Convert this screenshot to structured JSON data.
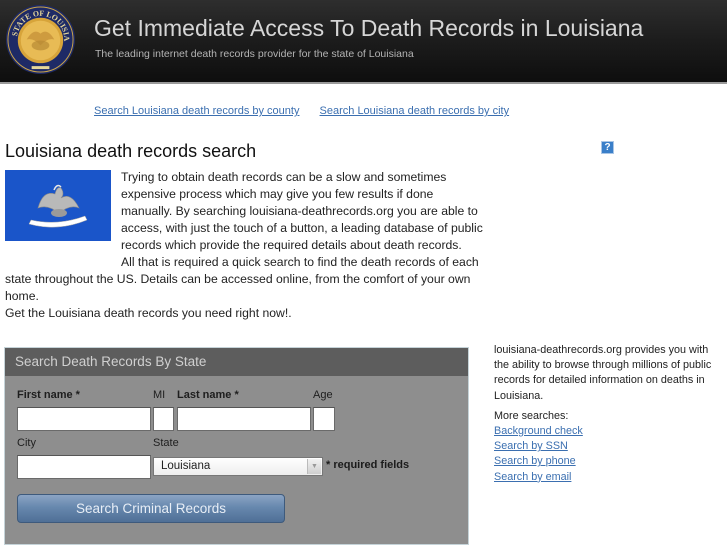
{
  "header": {
    "title": "Get Immediate Access To Death Records in Louisiana",
    "subtitle": "The leading internet death records provider for the state of Louisiana",
    "seal_icon": "state-of-louisiana-seal",
    "seal_text": "STATE OF LOUISIANA"
  },
  "top_links": [
    {
      "label": "Search Louisiana death records by county"
    },
    {
      "label": "Search Louisiana death records by city"
    }
  ],
  "main": {
    "title": "Louisiana death records search",
    "help_icon": "?",
    "flag_image": "louisiana-flag",
    "paragraphs": [
      "Trying to obtain death records can be a slow and sometimes expensive process which may give you few results if done manually. By searching louisiana-deathrecords.org you are able to access, with just the touch of a button, a leading database of public records which provide the required details about death records.",
      "All that is required a quick search to find the death records of each state throughout the US. Details can be accessed online, from the comfort of your own home.",
      "Get the Louisiana death records you need right now!."
    ]
  },
  "search_form": {
    "header": "Search Death Records By State",
    "fields": {
      "first_name": {
        "label": "First name *",
        "value": ""
      },
      "mi": {
        "label": "MI",
        "value": ""
      },
      "last_name": {
        "label": "Last name *",
        "value": ""
      },
      "age": {
        "label": "Age",
        "value": ""
      },
      "city": {
        "label": "City",
        "value": ""
      },
      "state": {
        "label": "State",
        "value": "Louisiana"
      }
    },
    "required_note": "* required fields",
    "submit_label": "Search Criminal Records"
  },
  "sidebar": {
    "description": "louisiana-deathrecords.org provides you with the ability to browse through millions of public records for detailed information on deaths in Louisiana.",
    "more_label": "More searches:",
    "links": [
      {
        "label": "Background check"
      },
      {
        "label": "Search by SSN"
      },
      {
        "label": "Search by phone"
      },
      {
        "label": "Search by email"
      }
    ]
  },
  "colors": {
    "header_bg": "#1c1c1c",
    "link": "#3b6fb0",
    "flag_blue": "#1a55c9",
    "form_bg": "#8e8e8e",
    "form_header_bg": "#5d5d5d",
    "button": "#6788ae"
  }
}
